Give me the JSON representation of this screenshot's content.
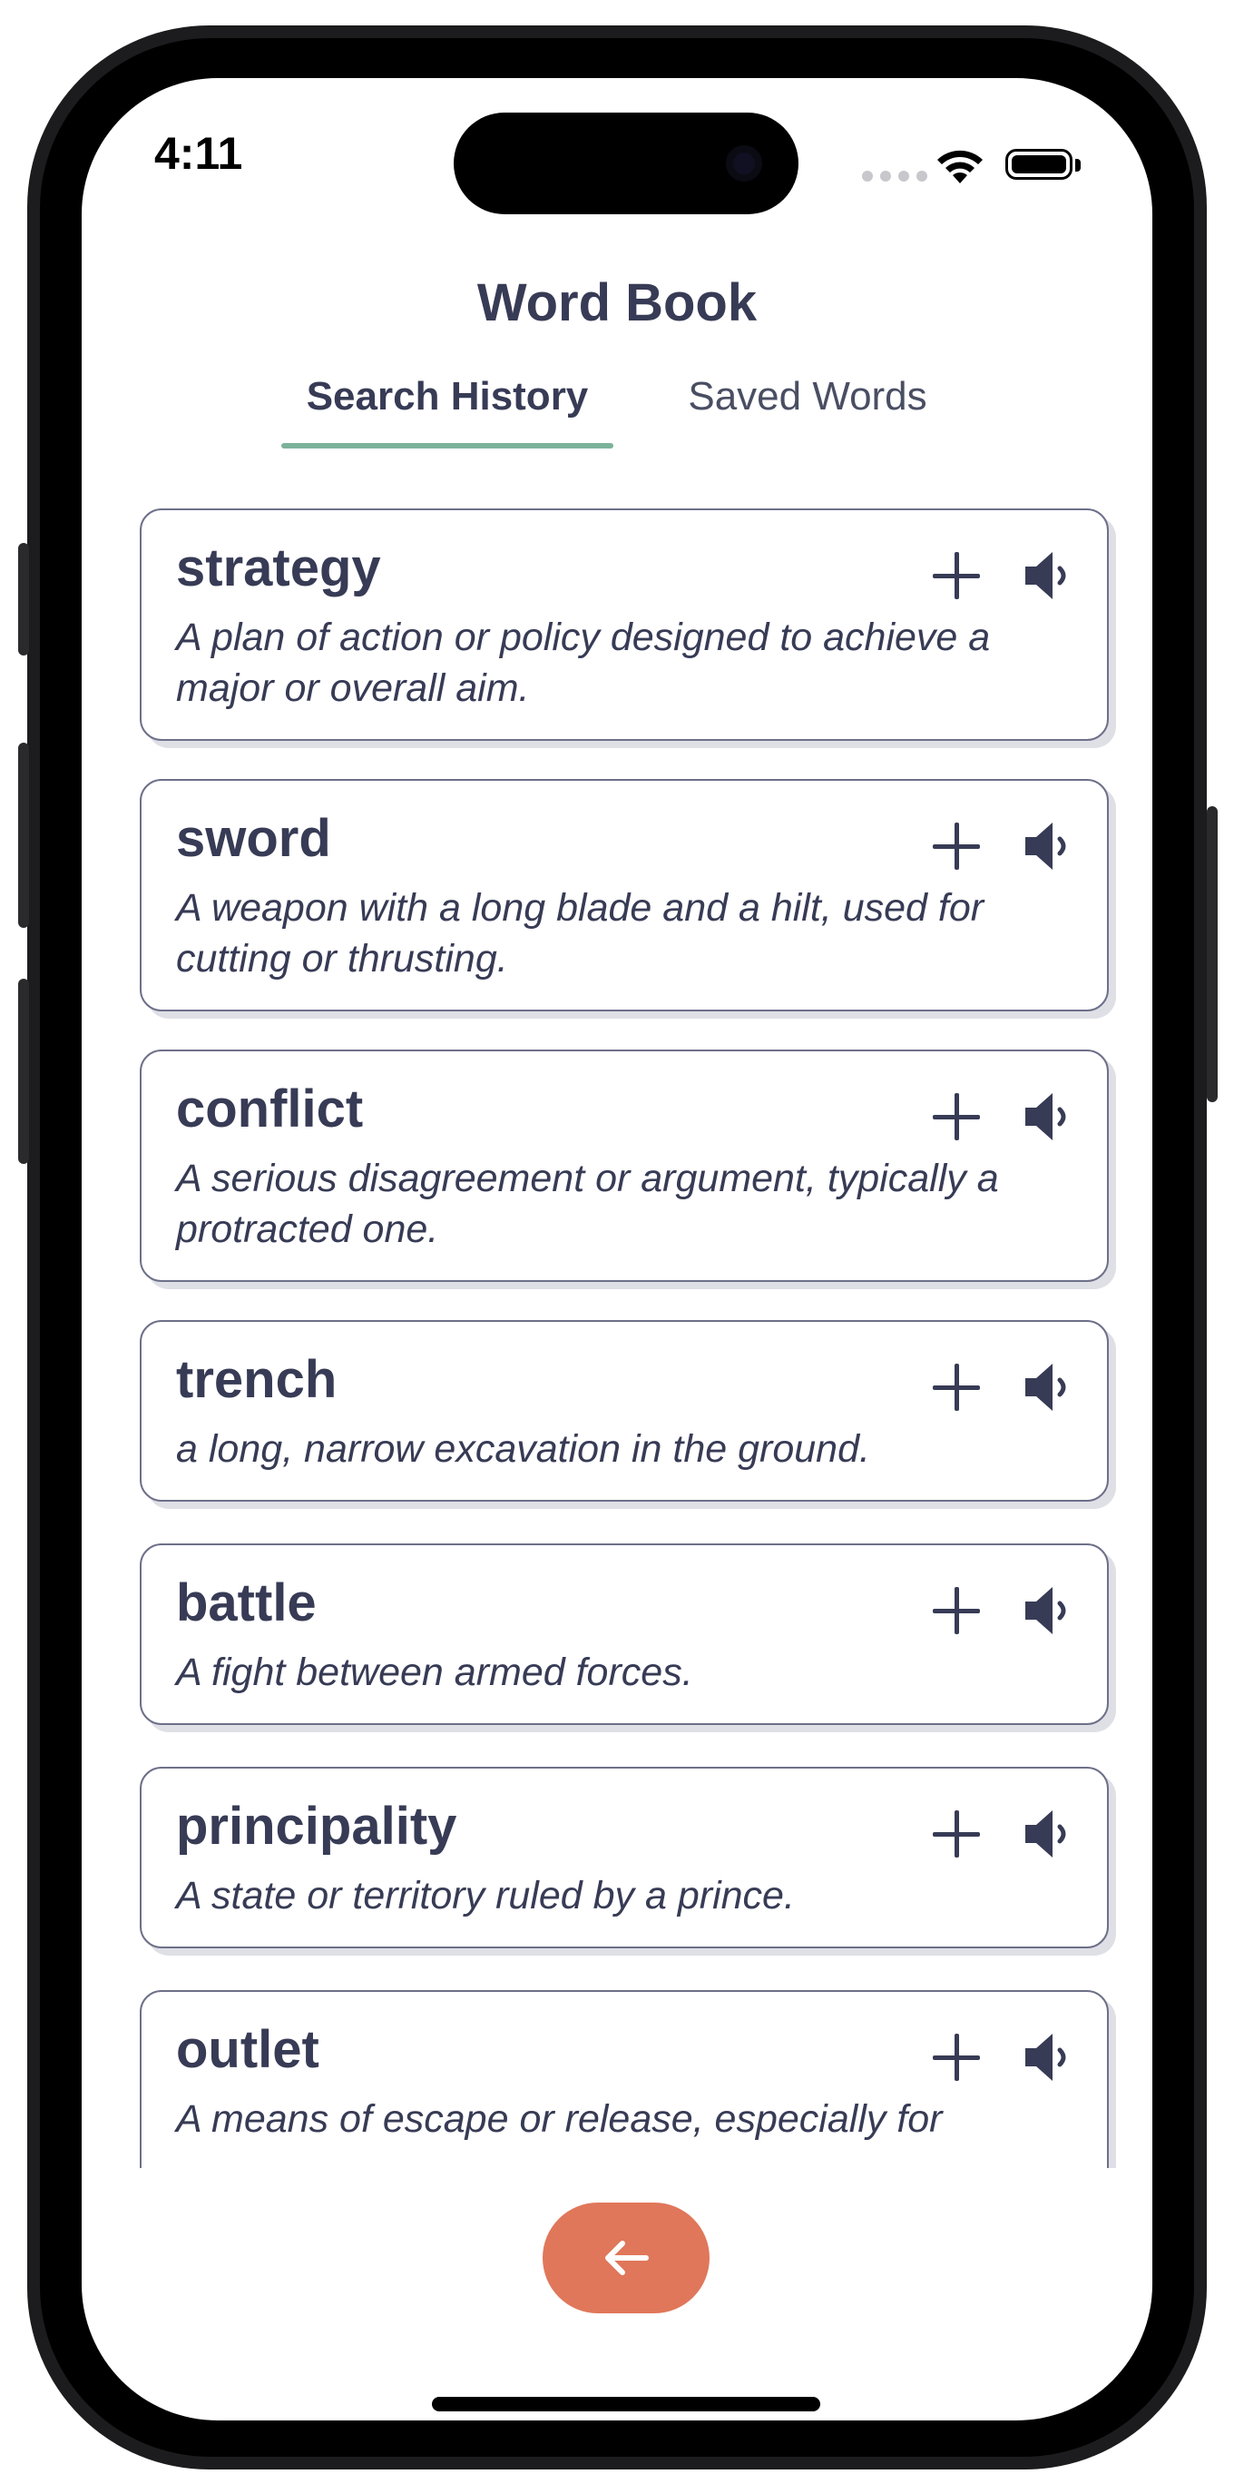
{
  "status_bar": {
    "time": "4:11"
  },
  "header": {
    "title": "Word Book",
    "tabs": [
      {
        "label": "Search History",
        "active": true
      },
      {
        "label": "Saved Words",
        "active": false
      }
    ]
  },
  "words": [
    {
      "word": "strategy",
      "definition": "A plan of action or policy designed to achieve a major or overall aim."
    },
    {
      "word": "sword",
      "definition": "A weapon with a long blade and a hilt, used for cutting or thrusting."
    },
    {
      "word": "conflict",
      "definition": "A serious disagreement or argument, typically a protracted one."
    },
    {
      "word": "trench",
      "definition": "a long, narrow excavation in the ground."
    },
    {
      "word": "battle",
      "definition": "A fight between armed forces."
    },
    {
      "word": "principality",
      "definition": "A state or territory ruled by a prince."
    },
    {
      "word": "outlet",
      "definition": "A means of escape or release, especially for"
    }
  ],
  "icons": {
    "add": "plus-icon",
    "speak": "speaker-icon",
    "back": "arrow-left-icon"
  },
  "colors": {
    "text": "#373b55",
    "accent_underline": "#7bb39a",
    "back_button": "#e0775a",
    "card_border": "#6d7089"
  }
}
